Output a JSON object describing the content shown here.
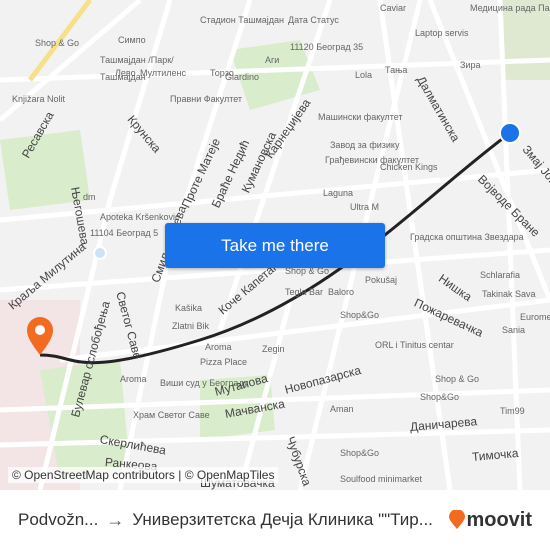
{
  "map": {
    "labels": [
      "Симпо",
      "Стадион Ташмајдан",
      "Дата Статус",
      "Caviar",
      "Медицина рада Палилула",
      "Shop & Go",
      "Ташмајдан /Парк/",
      "Ташмајдан",
      "Giardino",
      "Аги",
      "11120 Београд 35",
      "Laptop servis",
      "Лево",
      "Мултилeнс",
      "Торзо",
      "Lola",
      "Тања",
      "Зира",
      "Knjižara Nolit",
      "Правни Факултет",
      "Машински факултет",
      "Завод за физику",
      "Грађевински факултет",
      "Chicken Kings",
      "Laguna",
      "Ultra M",
      "dm",
      "Apoteka Kršenković",
      "11104 Београд 5",
      "Градска општина Звездара",
      "Shop & Go",
      "Tegla Bar",
      "Baloro",
      "Pokušaj",
      "Schlarafia",
      "Takinak Sava",
      "Euromed",
      "Sania",
      "Shop&Go",
      "ORL i Tinitus centar",
      "Kašika",
      "Zlatni Bik",
      "Aroma",
      "Zegin",
      "Pizza Place",
      "Виши суд у Београду",
      "Храм Светог Саве",
      "Aroma",
      "Shop & Go",
      "Shop&Go",
      "Aman",
      "Tim99",
      "Shop&Go",
      "Soulfood minimarket"
    ],
    "streets": [
      "Ресавска",
      "Крунска",
      "Његошева",
      "Проте Матеје",
      "Брaће Недић",
      "Кумановска",
      "Карнеџијева",
      "Далматинска",
      "Војводе Бране",
      "Змај Јовина",
      "Краља Милутина",
      "Светог Саве",
      "Коче Капетана",
      "Смиљанићева",
      "Булевар ослобођења",
      "Нишка",
      "Пожаревачка",
      "Мутапова",
      "Новопазарска",
      "Мачванска",
      "Скерлићева",
      "Даничарева",
      "Тимочка",
      "Чубурска",
      "Ранкеова",
      "Шуматовачка"
    ]
  },
  "cta_label": "Take me there",
  "attribution": "© OpenStreetMap contributors | © OpenMapTiles",
  "route": {
    "from": "Podvožn...",
    "to": "Универзитетска Дечја Клиника \"\"Тир..."
  },
  "brand": {
    "name": "moovit",
    "color": "#f26b21"
  },
  "colors": {
    "route": "#222222",
    "origin": "#1a73e8",
    "destination": "#f26b21",
    "button": "#1a73e8"
  }
}
